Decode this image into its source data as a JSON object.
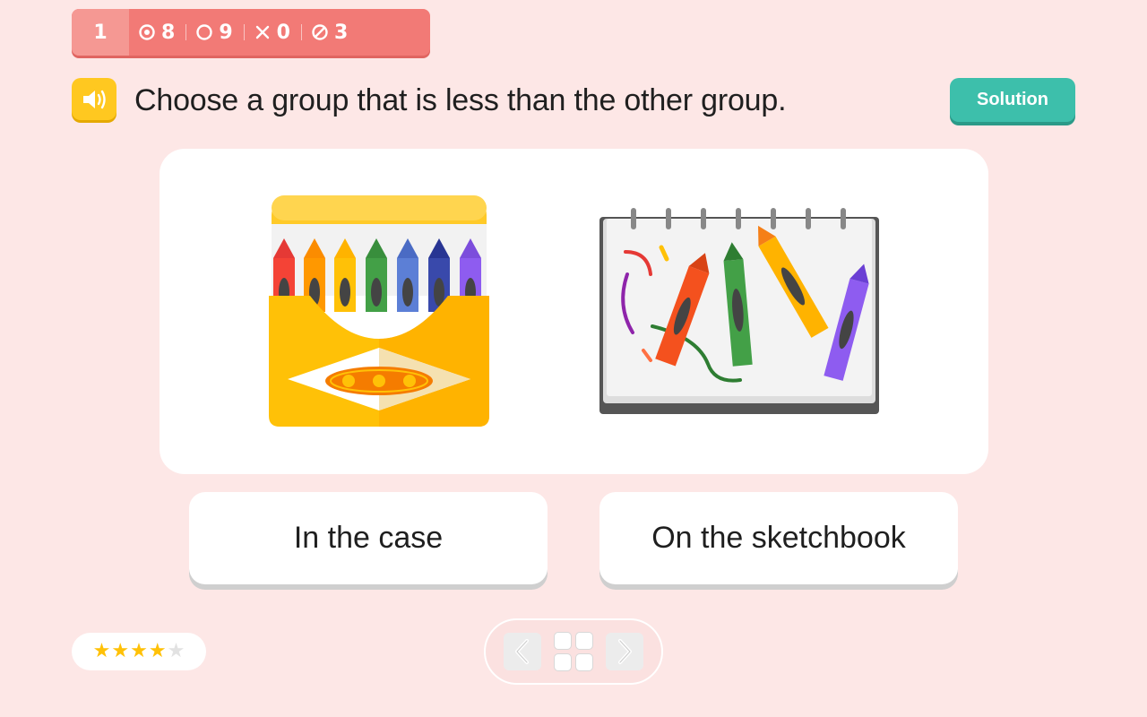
{
  "scorebar": {
    "question_number": "1",
    "correct": "8",
    "unanswered": "9",
    "wrong": "0",
    "skipped": "3"
  },
  "question": {
    "text": "Choose a group that is less than the other group.",
    "speaker_icon": "speaker-icon"
  },
  "solution": {
    "label": "Solution"
  },
  "answers": [
    {
      "label": "In the case"
    },
    {
      "label": "On the sketchbook"
    }
  ],
  "rating": {
    "filled": 4,
    "total": 5
  },
  "nav": {
    "prev_icon": "chevron-left-icon",
    "grid_icon": "grid-icon",
    "next_icon": "chevron-right-icon"
  },
  "colors": {
    "background": "#fde7e6",
    "scorebar": "#f27a76",
    "speaker": "#ffc820",
    "solution": "#3dbfab",
    "star": "#ffc107"
  }
}
